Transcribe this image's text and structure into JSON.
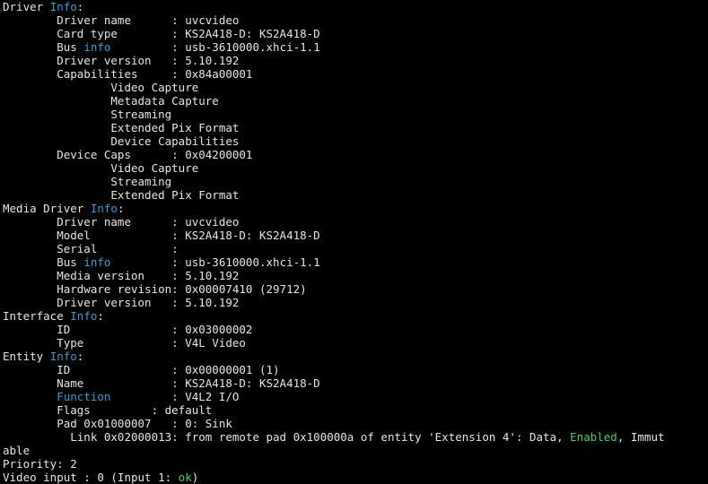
{
  "colors": {
    "background": "#000000",
    "text": "#e6e6e6",
    "keyword_highlight": "#2aa1d6",
    "status_highlight": "#3fcf6b"
  },
  "terminal": {
    "lines": [
      [
        {
          "t": "Driver "
        },
        {
          "t": "Info",
          "c": "info"
        },
        {
          "t": ":"
        }
      ],
      [
        {
          "t": "\tDriver name      : uvcvideo"
        }
      ],
      [
        {
          "t": "\tCard type        : KS2A418-D: KS2A418-D"
        }
      ],
      [
        {
          "t": "\tBus "
        },
        {
          "t": "info",
          "c": "info"
        },
        {
          "t": "         : usb-3610000.xhci-1.1"
        }
      ],
      [
        {
          "t": "\tDriver version   : 5.10.192"
        }
      ],
      [
        {
          "t": "\tCapabilities     : 0x84a00001"
        }
      ],
      [
        {
          "t": "\t\tVideo Capture"
        }
      ],
      [
        {
          "t": "\t\tMetadata Capture"
        }
      ],
      [
        {
          "t": "\t\tStreaming"
        }
      ],
      [
        {
          "t": "\t\tExtended Pix Format"
        }
      ],
      [
        {
          "t": "\t\tDevice Capabilities"
        }
      ],
      [
        {
          "t": "\tDevice Caps      : 0x04200001"
        }
      ],
      [
        {
          "t": "\t\tVideo Capture"
        }
      ],
      [
        {
          "t": "\t\tStreaming"
        }
      ],
      [
        {
          "t": "\t\tExtended Pix Format"
        }
      ],
      [
        {
          "t": "Media Driver "
        },
        {
          "t": "Info",
          "c": "info"
        },
        {
          "t": ":"
        }
      ],
      [
        {
          "t": "\tDriver name      : uvcvideo"
        }
      ],
      [
        {
          "t": "\tModel            : KS2A418-D: KS2A418-D"
        }
      ],
      [
        {
          "t": "\tSerial           :"
        }
      ],
      [
        {
          "t": "\tBus "
        },
        {
          "t": "info",
          "c": "info"
        },
        {
          "t": "         : usb-3610000.xhci-1.1"
        }
      ],
      [
        {
          "t": "\tMedia version    : 5.10.192"
        }
      ],
      [
        {
          "t": "\tHardware revision: 0x00007410 (29712)"
        }
      ],
      [
        {
          "t": "\tDriver version   : 5.10.192"
        }
      ],
      [
        {
          "t": "Interface "
        },
        {
          "t": "Info",
          "c": "info"
        },
        {
          "t": ":"
        }
      ],
      [
        {
          "t": "\tID               : 0x03000002"
        }
      ],
      [
        {
          "t": "\tType             : V4L Video"
        }
      ],
      [
        {
          "t": "Entity "
        },
        {
          "t": "Info",
          "c": "info"
        },
        {
          "t": ":"
        }
      ],
      [
        {
          "t": "\tID               : 0x00000001 (1)"
        }
      ],
      [
        {
          "t": "\tName             : KS2A418-D: KS2A418-D"
        }
      ],
      [
        {
          "t": "\t"
        },
        {
          "t": "Function",
          "c": "info"
        },
        {
          "t": "         : V4L2 I/O"
        }
      ],
      [
        {
          "t": "\tFlags         : default"
        }
      ],
      [
        {
          "t": "\tPad 0x01000007   : 0: Sink"
        }
      ],
      [
        {
          "t": "\t  Link 0x02000013: from remote pad 0x100000a of entity 'Extension 4': Data, "
        },
        {
          "t": "Enabled",
          "c": "green"
        },
        {
          "t": ", Immut"
        }
      ],
      [
        {
          "t": "able"
        }
      ],
      [
        {
          "t": "Priority: 2"
        }
      ],
      [
        {
          "t": "Video input : 0 (Input 1: "
        },
        {
          "t": "ok",
          "c": "green"
        },
        {
          "t": ")"
        }
      ]
    ]
  }
}
